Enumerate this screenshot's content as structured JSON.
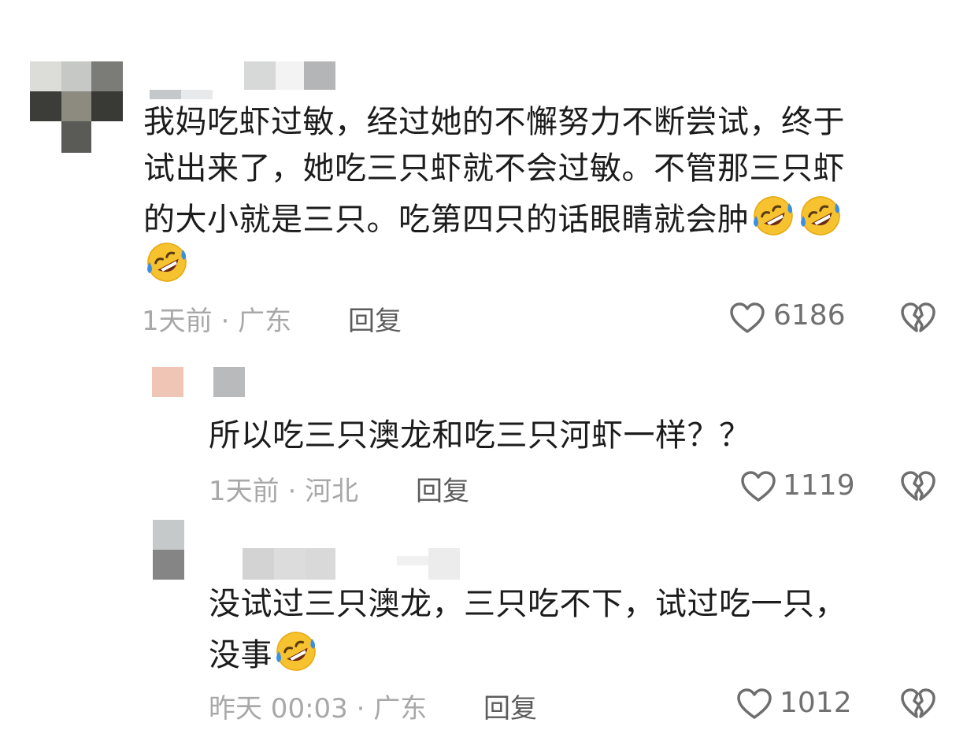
{
  "comments": [
    {
      "text_lines": [
        "我妈吃虾过敏，经过她的不懈努力不断尝试，终于",
        "试出来了，她吃三只虾就不会过敏。不管那三只虾",
        "的大小就是三只。吃第四只的话眼睛就会肿"
      ],
      "emoji_name": "rolling-on-floor-laughing",
      "time": "1天前",
      "location": "广东",
      "reply_label": "回复",
      "likes": "6186"
    },
    {
      "text_lines": [
        "所以吃三只澳龙和吃三只河虾一样？？"
      ],
      "time": "1天前",
      "location": "河北",
      "reply_label": "回复",
      "likes": "1119"
    },
    {
      "text_lines": [
        "没试过三只澳龙，三只吃不下，试过吃一只，",
        "没事"
      ],
      "emoji_name": "rolling-on-floor-laughing",
      "time": "昨天 00:03",
      "location": "广东",
      "reply_label": "回复",
      "likes": "1012"
    }
  ],
  "separator": "·",
  "icons": {
    "like": "heart-outline-icon",
    "dislike": "broken-heart-icon"
  },
  "colors": {
    "text": "#1c1c1c",
    "meta": "#a8a8a8",
    "icon": "#6e6e6e",
    "emoji_face": "#f7c22f",
    "tear": "#3b8fe3"
  }
}
